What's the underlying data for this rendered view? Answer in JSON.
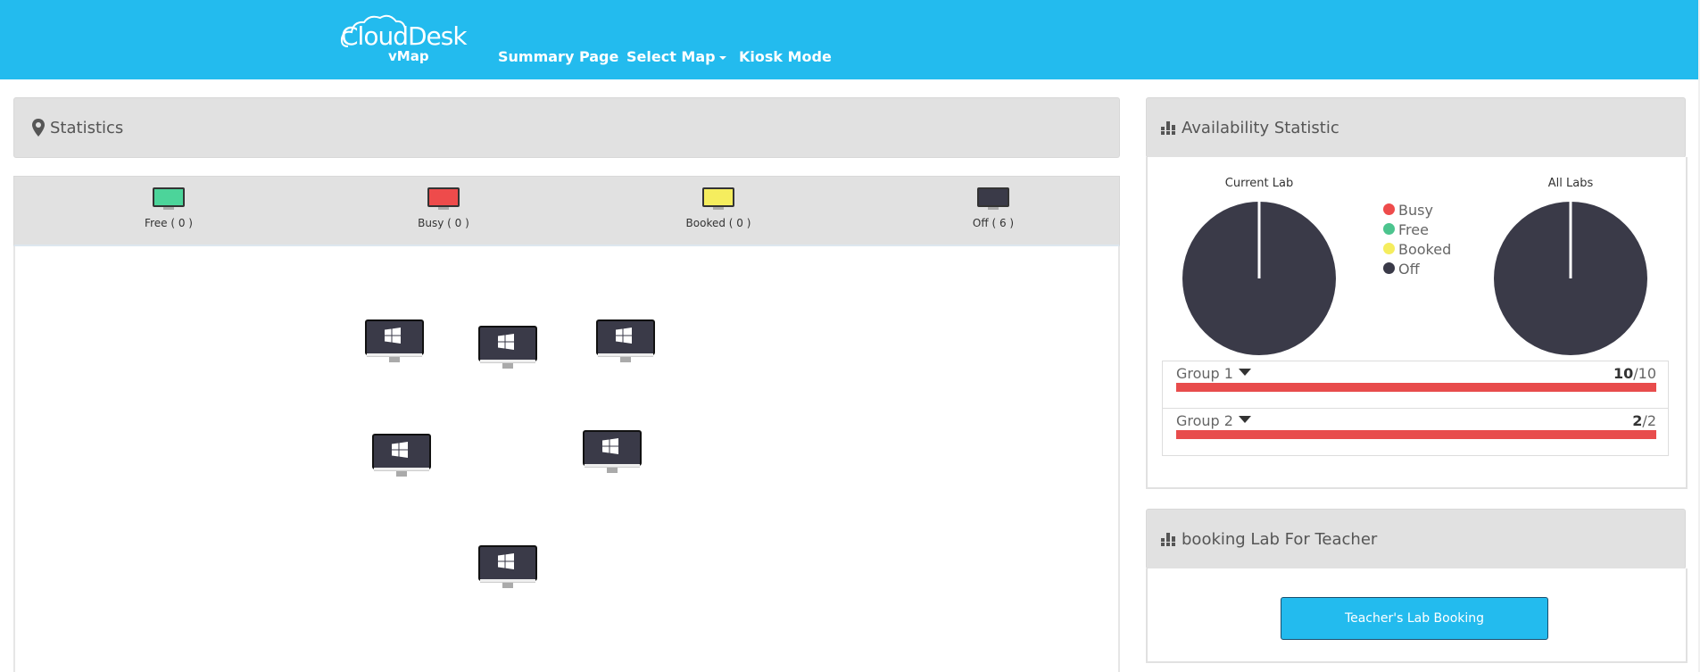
{
  "brand": {
    "logo_text": "CloudDesk",
    "logo_sub": "vMap"
  },
  "nav": {
    "summary_label": "Summary Page",
    "select_map_label": "Select Map",
    "kiosk_label": "Kiosk Mode"
  },
  "statistics": {
    "title": "Statistics",
    "icon": "map-marker-icon"
  },
  "legend": {
    "items": [
      {
        "label": "Free ( 0 )",
        "color": "#4cd49a"
      },
      {
        "label": "Busy ( 0 )",
        "color": "#ee4b4b"
      },
      {
        "label": "Booked ( 0 )",
        "color": "#f5ed5e"
      },
      {
        "label": "Off ( 6 )",
        "color": "#3a3a48"
      }
    ]
  },
  "map": {
    "computers": [
      {
        "state": "off",
        "icon": "windows-icon"
      },
      {
        "state": "off",
        "icon": "windows-icon"
      },
      {
        "state": "off",
        "icon": "windows-icon"
      },
      {
        "state": "off",
        "icon": "windows-icon"
      },
      {
        "state": "off",
        "icon": "windows-icon"
      },
      {
        "state": "off",
        "icon": "windows-icon"
      }
    ]
  },
  "availability": {
    "title": "Availability Statistic",
    "icon": "bar-chart-icon",
    "current_lab_label": "Current Lab",
    "all_labs_label": "All Labs",
    "legend": [
      {
        "label": "Busy",
        "color": "#ee4b4b"
      },
      {
        "label": "Free",
        "color": "#4cc48e"
      },
      {
        "label": "Booked",
        "color": "#f5ed5e"
      },
      {
        "label": "Off",
        "color": "#3a3a48"
      }
    ],
    "groups": [
      {
        "name": "Group 1",
        "count": "10",
        "total": "/10",
        "fill_fraction": 1.0
      },
      {
        "name": "Group 2",
        "count": "2",
        "total": "/2",
        "fill_fraction": 1.0
      }
    ]
  },
  "booking": {
    "title": "booking Lab For Teacher",
    "icon": "bar-chart-icon",
    "button_label": "Teacher's Lab Booking"
  },
  "chart_data": [
    {
      "type": "pie",
      "title": "Current Lab",
      "categories": [
        "Busy",
        "Free",
        "Booked",
        "Off"
      ],
      "values": [
        0,
        0,
        0,
        6
      ]
    },
    {
      "type": "pie",
      "title": "All Labs",
      "categories": [
        "Busy",
        "Free",
        "Booked",
        "Off"
      ],
      "values": [
        0,
        0,
        0,
        6
      ]
    }
  ]
}
